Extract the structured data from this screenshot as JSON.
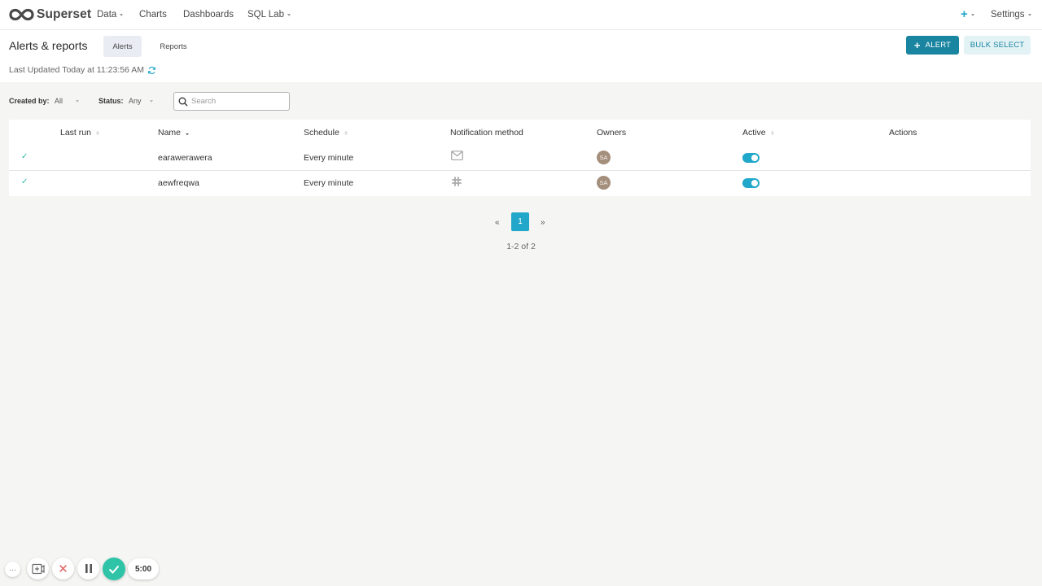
{
  "nav": {
    "brand": "Superset",
    "items": [
      {
        "label": "Data",
        "has_caret": true
      },
      {
        "label": "Charts",
        "has_caret": false
      },
      {
        "label": "Dashboards",
        "has_caret": false
      },
      {
        "label": "SQL Lab",
        "has_caret": true
      }
    ],
    "plus_label": "+",
    "settings_label": "Settings"
  },
  "header": {
    "title": "Alerts & reports",
    "tabs": [
      {
        "label": "Alerts",
        "active": true
      },
      {
        "label": "Reports",
        "active": false
      }
    ],
    "alert_button": "ALERT",
    "alert_button_icon": "+",
    "bulk_select_button": "BULK SELECT",
    "last_updated": "Last Updated Today at 11:23:56 AM"
  },
  "filters": {
    "created_by_label": "Created by:",
    "created_by_value": "All",
    "status_label": "Status:",
    "status_value": "Any",
    "search_placeholder": "Search"
  },
  "table": {
    "columns": [
      "Last run",
      "Name",
      "Schedule",
      "Notification method",
      "Owners",
      "Active",
      "Actions"
    ],
    "rows": [
      {
        "status_icon": "check-icon",
        "check": "✓",
        "last_run": "",
        "name": "earawerawera",
        "schedule": "Every minute",
        "notification": "email-icon",
        "owner": "SA",
        "active": true
      },
      {
        "status_icon": "check-icon",
        "check": "✓",
        "last_run": "",
        "name": "aewfreqwa",
        "schedule": "Every minute",
        "notification": "slack-icon",
        "owner": "SA",
        "active": true
      }
    ]
  },
  "pagination": {
    "prev": "«",
    "current": "1",
    "next": "»",
    "count": "1-2 of 2"
  },
  "recorder": {
    "more": "···",
    "close": "✕",
    "timer": "5:00"
  },
  "colors": {
    "primary": "#20a7c9",
    "primary_dark": "#1a85a0",
    "success": "#2fb8a4",
    "avatar": "#a48e7c"
  }
}
